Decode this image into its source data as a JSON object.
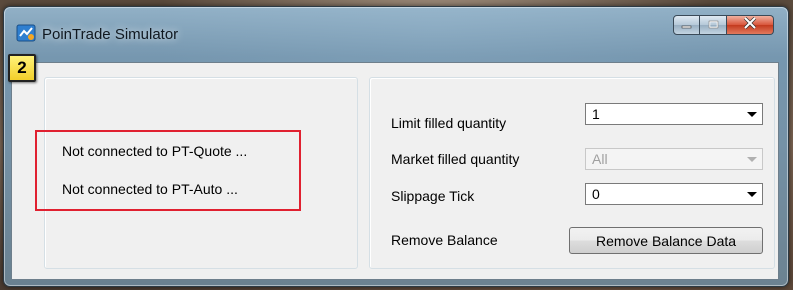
{
  "window": {
    "title": "PoinTrade Simulator",
    "icon": "app-icon",
    "controls": {
      "minimize_icon": "minimize-icon",
      "maximize_icon": "maximize-icon",
      "close_icon": "close-icon"
    }
  },
  "connection": {
    "callout_number": "2",
    "highlight_color": "#e02030",
    "quote_status": "Not connected to PT-Quote ...",
    "auto_status": "Not connected to PT-Auto ..."
  },
  "settings": {
    "limit_filled_quantity": {
      "label": "Limit filled quantity",
      "value": "1"
    },
    "market_filled_quantity": {
      "label": "Market filled quantity",
      "value": "All",
      "disabled": true
    },
    "slippage_tick": {
      "label": "Slippage Tick",
      "value": "0"
    },
    "remove_balance": {
      "label": "Remove Balance",
      "button_label": "Remove Balance Data"
    }
  }
}
